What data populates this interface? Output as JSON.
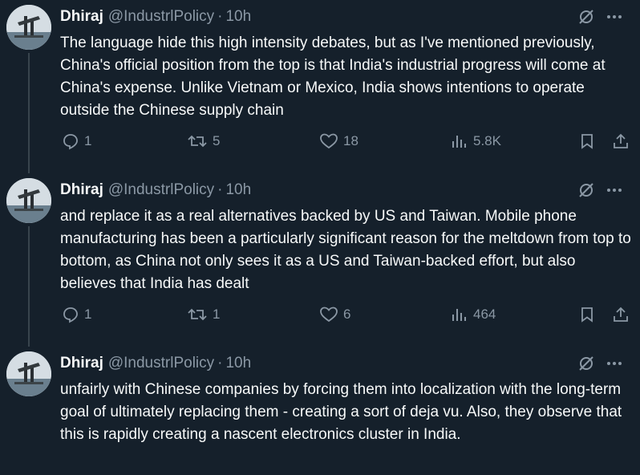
{
  "tweets": [
    {
      "name": "Dhiraj",
      "handle": "@IndustrlPolicy",
      "dot": "·",
      "time": "10h",
      "text": "The language hide this high intensity debates, but as I've mentioned previously, China's official position from the top is that India's industrial progress will come at China's expense. Unlike Vietnam or Mexico, India shows intentions to operate outside the Chinese supply chain",
      "replies": "1",
      "reposts": "5",
      "likes": "18",
      "views": "5.8K"
    },
    {
      "name": "Dhiraj",
      "handle": "@IndustrlPolicy",
      "dot": "·",
      "time": "10h",
      "text": "and replace it as a real alternatives backed by US and Taiwan. Mobile phone manufacturing has been a particularly significant reason for the meltdown from top to bottom, as China not only sees it as a US and Taiwan-backed effort, but also believes that India has dealt",
      "replies": "1",
      "reposts": "1",
      "likes": "6",
      "views": "464"
    },
    {
      "name": "Dhiraj",
      "handle": "@IndustrlPolicy",
      "dot": "·",
      "time": "10h",
      "text": "unfairly with Chinese companies by forcing them into localization with the long-term goal of ultimately replacing them - creating a sort of deja vu. Also, they observe that this is rapidly creating a nascent electronics cluster in India."
    }
  ],
  "icons": {
    "grok": "grok-slash-icon",
    "more": "more-dots-icon",
    "reply": "reply-icon",
    "repost": "repost-icon",
    "like": "heart-icon",
    "views": "views-chart-icon",
    "bookmark": "bookmark-icon",
    "share": "share-icon"
  },
  "colors": {
    "background": "#15202b",
    "text": "#f7f9f9",
    "secondary": "#8b98a5",
    "thread_line": "#38444d"
  }
}
